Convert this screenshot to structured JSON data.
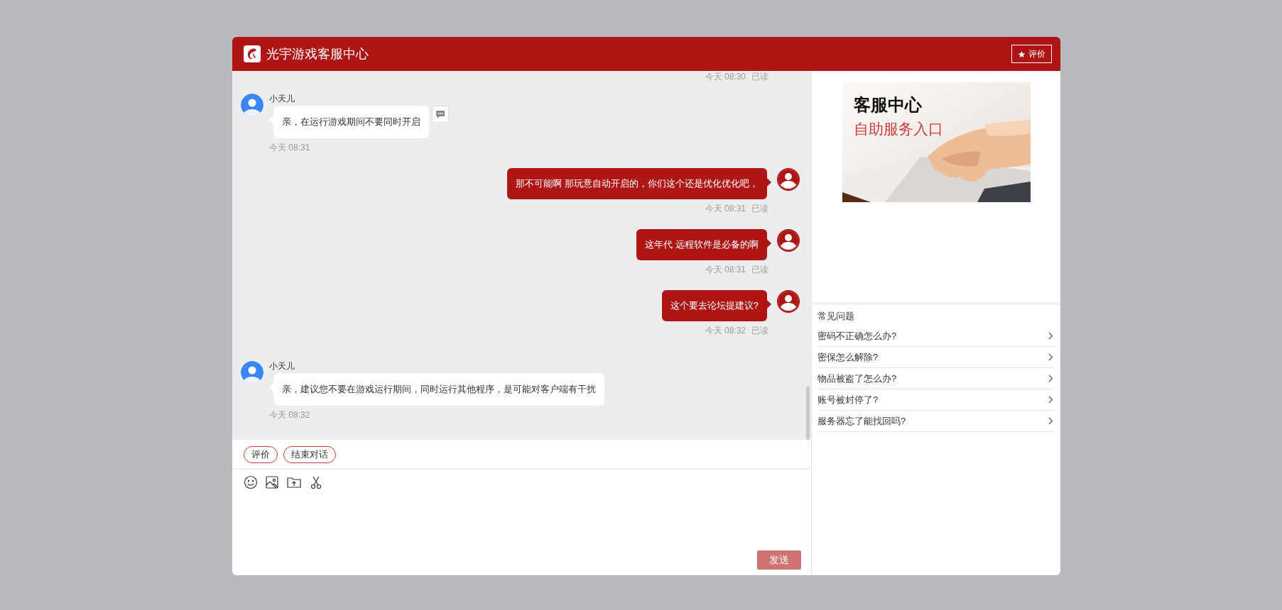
{
  "header": {
    "title": "光宇游戏客服中心",
    "rate_button": "评价"
  },
  "top_status": {
    "time": "今天 08:30",
    "read": "已读"
  },
  "messages": [
    {
      "kind": "agent",
      "sender": "小天儿",
      "text": "亲，在运行游戏期间不要同时开启",
      "time": "今天 08:31",
      "has_action": true
    },
    {
      "kind": "user",
      "text": "那不可能啊 那玩意自动开启的，你们这个还是优化优化吧，",
      "time": "今天 08:31",
      "read": "已读"
    },
    {
      "kind": "user",
      "text": "这年代 远程软件是必备的啊",
      "time": "今天 08:31",
      "read": "已读"
    },
    {
      "kind": "user",
      "text": "这个要去论坛提建议?",
      "time": "今天 08:32",
      "read": "已读"
    },
    {
      "kind": "agent",
      "sender": "小天儿",
      "text": "亲，建议您不要在游戏运行期间，同时运行其他程序，是可能对客户端有干扰",
      "time": "今天 08:32",
      "has_action": false
    }
  ],
  "quick_actions": [
    "评价",
    "结束对话"
  ],
  "send_button": {
    "label": "发送",
    "disabled": true
  },
  "banner": {
    "kind": "picture",
    "title": "客服中心",
    "subtitle": "自助服务入口"
  },
  "faq": {
    "title": "常见问题",
    "items": [
      "密码不正确怎么办?",
      "密保怎么解除?",
      "物品被盗了怎么办?",
      "账号被封停了?",
      "服务器忘了能找回吗?"
    ]
  }
}
